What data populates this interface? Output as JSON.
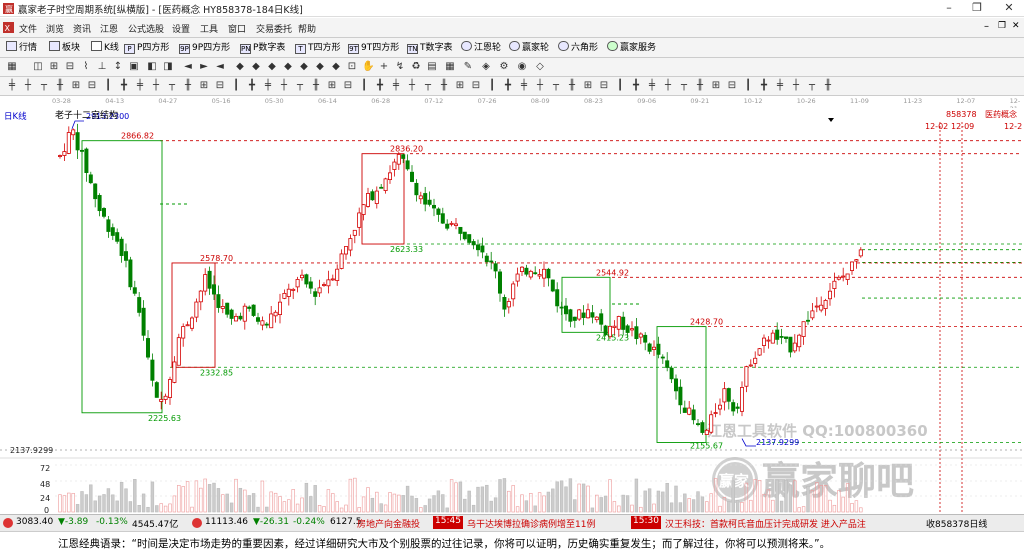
{
  "window": {
    "title": "赢家老子时空周期系统[纵横版] - [医药概念  HY858378-184日K线]",
    "min": "–",
    "max": "❐",
    "close": "✕"
  },
  "menu": [
    "文件",
    "浏览",
    "资讯",
    "江恩",
    "公式选股",
    "设置",
    "工具",
    "窗口",
    "交易委托",
    "帮助"
  ],
  "toolbar1": [
    {
      "label": "行情",
      "icon": "grid-icon"
    },
    {
      "label": "板块",
      "icon": "blocks-icon"
    },
    {
      "label": "K线",
      "icon": "kline-icon"
    },
    {
      "label": "P四方形",
      "icon": "p-square-icon",
      "badge": "P"
    },
    {
      "label": "9P四方形",
      "icon": "9p-square-icon",
      "badge": "9P"
    },
    {
      "label": "P数字表",
      "icon": "p-table-icon",
      "badge": "PN"
    },
    {
      "label": "T四方形",
      "icon": "t-square-icon",
      "badge": "T"
    },
    {
      "label": "9T四方形",
      "icon": "9t-square-icon",
      "badge": "9T"
    },
    {
      "label": "T数字表",
      "icon": "t-table-icon",
      "badge": "TN"
    },
    {
      "label": "江恩轮",
      "icon": "gann-wheel-icon"
    },
    {
      "label": "赢家轮",
      "icon": "winner-wheel-icon"
    },
    {
      "label": "六角形",
      "icon": "hexagon-icon"
    },
    {
      "label": "赢家服务",
      "icon": "service-icon"
    }
  ],
  "date_axis": [
    "03-28",
    "04-13",
    "04-27",
    "05-16",
    "05-30",
    "06-14",
    "06-28",
    "07-12",
    "07-26",
    "08-09",
    "08-23",
    "09-06",
    "09-21",
    "10-12",
    "10-26",
    "11-09",
    "11-23",
    "12-07",
    "12-21"
  ],
  "chart": {
    "period_label": "日K线",
    "structure_label": "老子十二宫结构",
    "code": "858378",
    "name": "医药概念",
    "date_a": "12-02",
    "date_b": "12-09",
    "date_c": "12-2",
    "price_labels": {
      "high1": "2913.2300",
      "p2866": "2866.82",
      "p2578": "2578.70",
      "p2836": "2836.20",
      "p2623": "2623.33",
      "p2544": "2544.92",
      "p2428": "2428.70",
      "p2415": "2415.23",
      "p2332": "2332.85",
      "p2225": "2225.63",
      "p2155": "2155.67",
      "p2137": "2137.9299",
      "low_axis": "2137.9299"
    },
    "vol_axis": [
      "72",
      "48",
      "24",
      "0"
    ],
    "watermark_tool": "江恩工具软件  QQ:100800360",
    "watermark_brand": "赢家聊吧",
    "watermark_seal": "赢家"
  },
  "statusbar": {
    "idx1": "3083.40",
    "idx1_chg": "▼-3.89",
    "idx1_pct": "-0.13%",
    "idx1_amt": "4545.47亿",
    "idx2": "11113.46",
    "idx2_chg": "▼-26.31",
    "idx2_pct": "-0.24%",
    "idx2_amt": "6127.5",
    "news1": "房地产向金融投",
    "time1": "15:45",
    "news2": "乌干达埃博拉确诊病例增至11例",
    "time2": "15:30",
    "news3": "汉王科技：首款柯氏音血压计完成研发 进入产品注",
    "right": "收858378日线"
  },
  "quote": "江恩经典语录：“时间是决定市场走势的重要因素，经过详细研究大市及个别股票的过往记录，你将可以证明，历史确实重复发生；而了解过往，你将可以预测将来。”。"
}
